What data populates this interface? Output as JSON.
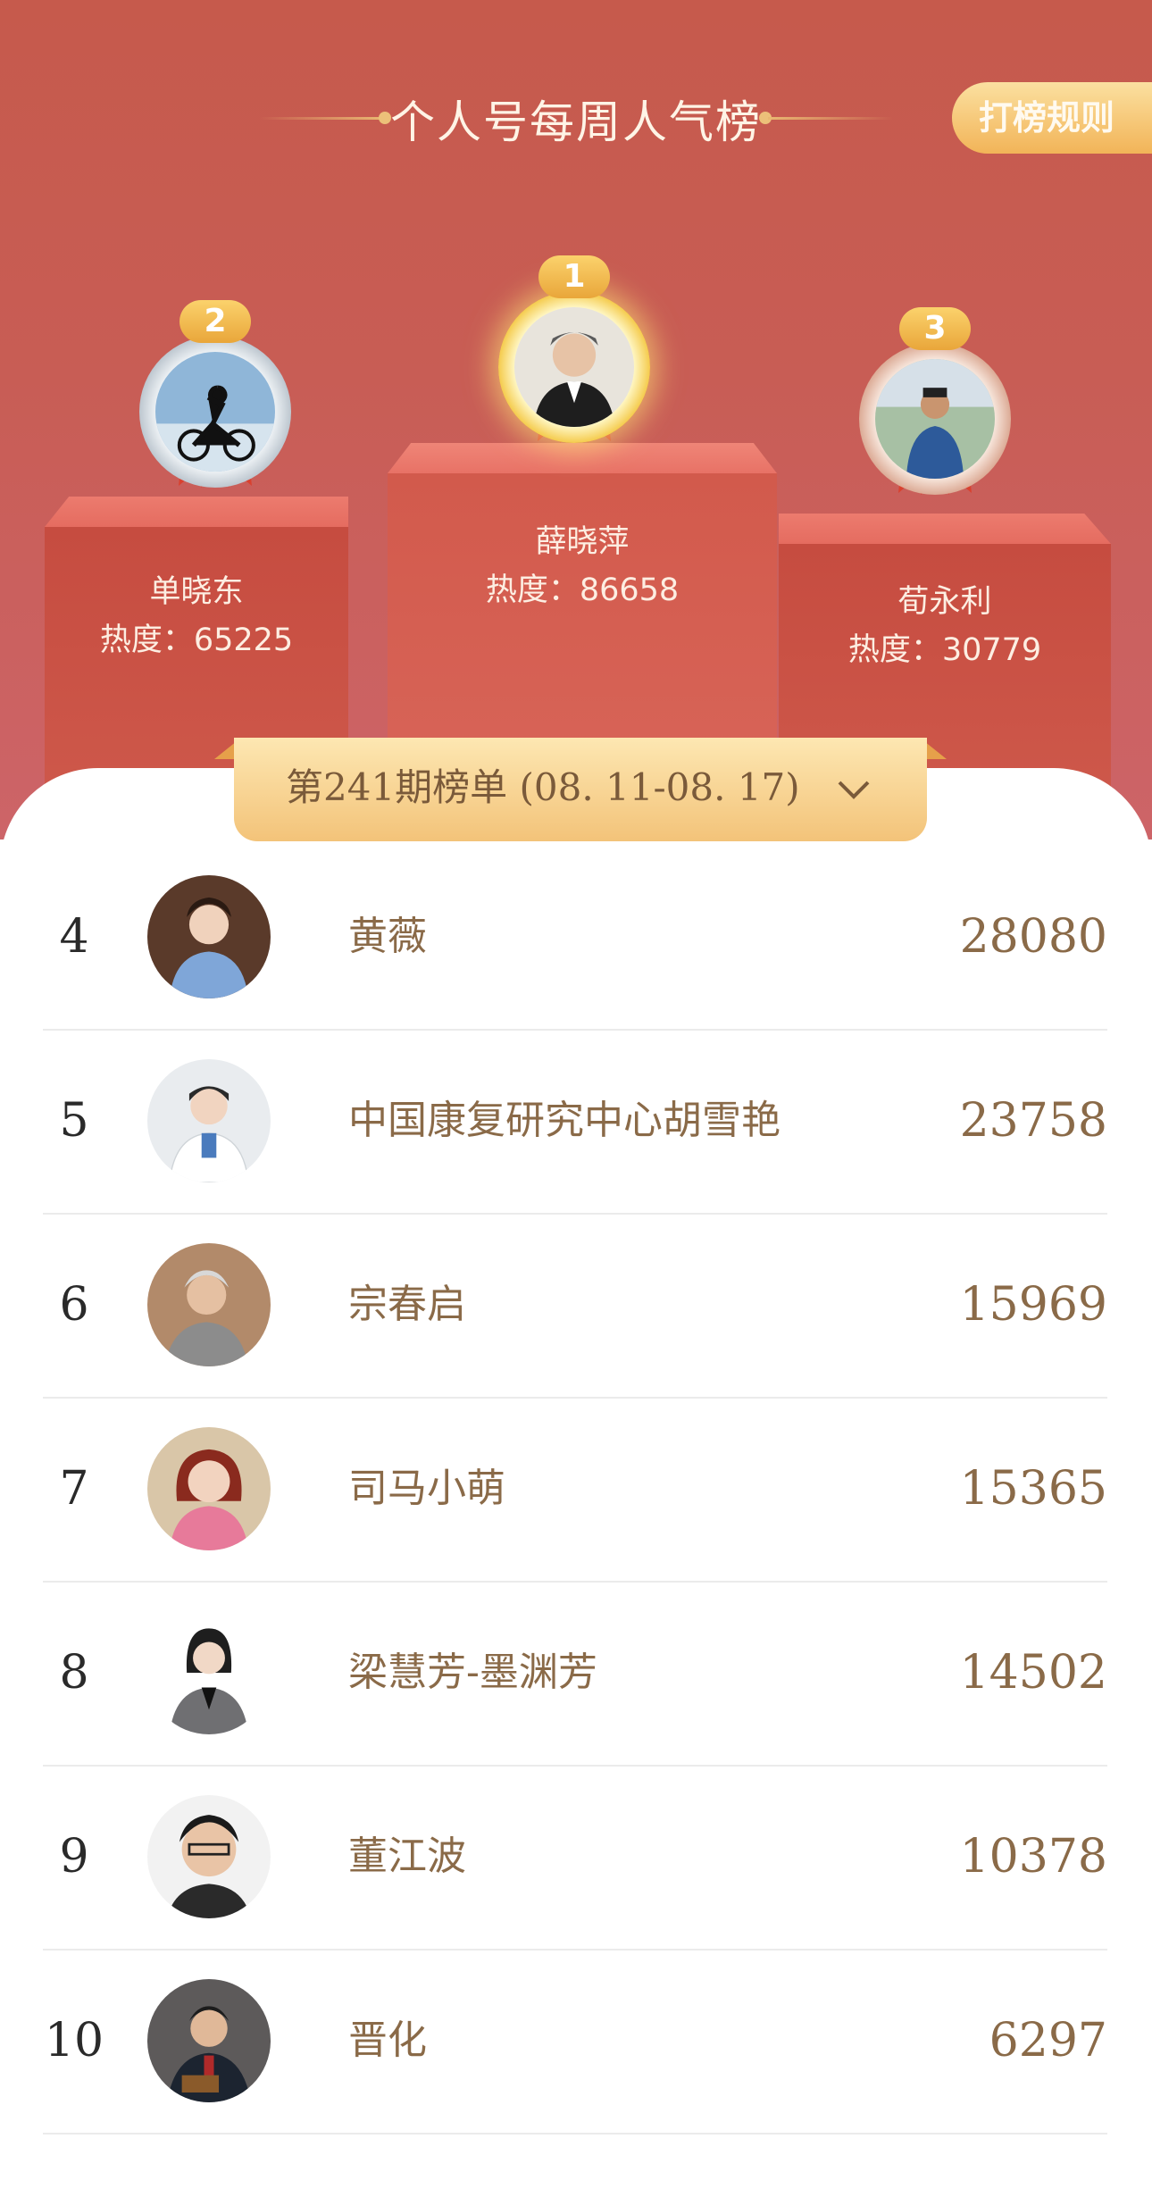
{
  "header": {
    "title": "个人号每周人气榜",
    "rules_button": "打榜规则"
  },
  "podium": [
    {
      "rank": "1",
      "name": "薛晓萍",
      "heat": "热度：86658"
    },
    {
      "rank": "2",
      "name": "单晓东",
      "heat": "热度：65225"
    },
    {
      "rank": "3",
      "name": "荀永利",
      "heat": "热度：30779"
    }
  ],
  "period": {
    "label": "第241期榜单 (08. 11-08. 17)"
  },
  "ranking": [
    {
      "rank": "4",
      "name": "黄薇",
      "score": "28080"
    },
    {
      "rank": "5",
      "name": "中国康复研究中心胡雪艳",
      "score": "23758"
    },
    {
      "rank": "6",
      "name": "宗春启",
      "score": "15969"
    },
    {
      "rank": "7",
      "name": "司马小萌",
      "score": "15365"
    },
    {
      "rank": "8",
      "name": "梁慧芳-墨渊芳",
      "score": "14502"
    },
    {
      "rank": "9",
      "name": "董江波",
      "score": "10378"
    },
    {
      "rank": "10",
      "name": "晋化",
      "score": "6297"
    }
  ],
  "colors": {
    "header_bg": "#c85d55",
    "podium_top": "#ec7b6e",
    "gold": "#f2b458",
    "list_text": "#8a6a48"
  }
}
